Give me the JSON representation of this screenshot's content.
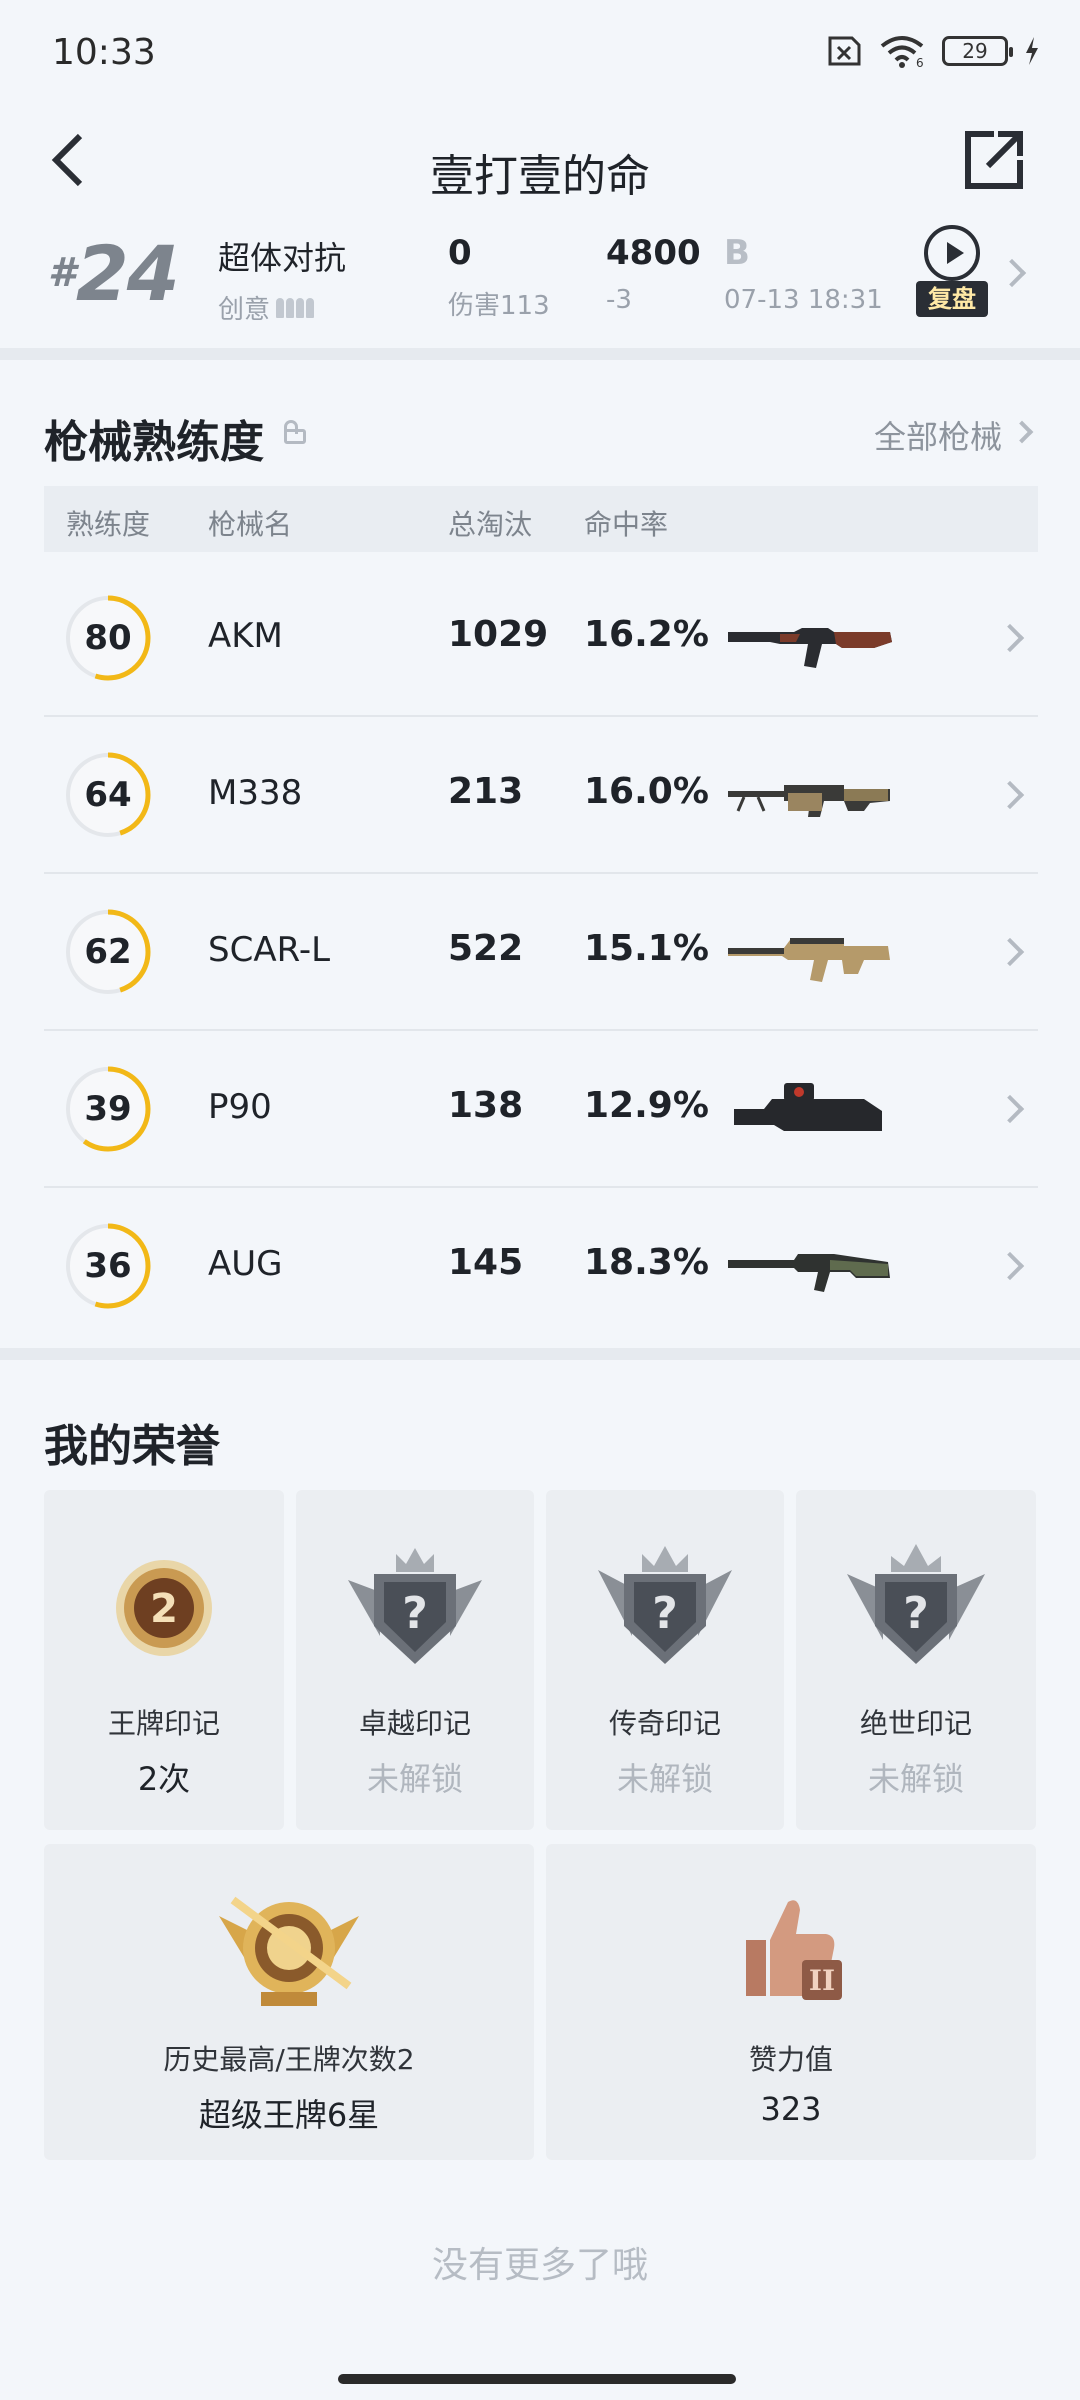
{
  "status": {
    "time": "10:33",
    "battery": "29",
    "wifi_level": "6"
  },
  "header": {
    "title": "壹打壹的命"
  },
  "match": {
    "rank_prefix": "#",
    "rank": "24",
    "mode": "超体对抗",
    "mode_sub": "创意",
    "damage_value": "0",
    "damage_label": "伤害113",
    "score": "4800",
    "score_change": "-3",
    "grade": "B",
    "time": "07-13 18:31",
    "replay_label": "复盘"
  },
  "weapons": {
    "title": "枪械熟练度",
    "all_label": "全部枪械",
    "columns": [
      "熟练度",
      "枪械名",
      "总淘汰",
      "命中率"
    ],
    "rows": [
      {
        "level": "80",
        "name": "AKM",
        "kills": "1029",
        "rate": "16.2%",
        "progress": 0.55
      },
      {
        "level": "64",
        "name": "M338",
        "kills": "213",
        "rate": "16.0%",
        "progress": 0.45
      },
      {
        "level": "62",
        "name": "SCAR-L",
        "kills": "522",
        "rate": "15.1%",
        "progress": 0.45
      },
      {
        "level": "39",
        "name": "P90",
        "kills": "138",
        "rate": "12.9%",
        "progress": 0.6
      },
      {
        "level": "36",
        "name": "AUG",
        "kills": "145",
        "rate": "18.3%",
        "progress": 0.55
      }
    ]
  },
  "honors": {
    "title": "我的荣誉",
    "cards": [
      {
        "label": "王牌印记",
        "value": "2次",
        "badge_num": "2"
      },
      {
        "label": "卓越印记",
        "value": "未解锁"
      },
      {
        "label": "传奇印记",
        "value": "未解锁"
      },
      {
        "label": "绝世印记",
        "value": "未解锁"
      }
    ],
    "wide_cards": [
      {
        "label": "历史最高/王牌次数2",
        "value": "超级王牌6星"
      },
      {
        "label": "赞力值",
        "value": "323"
      }
    ]
  },
  "footer": {
    "no_more": "没有更多了哦"
  },
  "colors": {
    "ring": "#f2b817",
    "ring_track": "#e4e7eb",
    "background": "#f3f6fa"
  },
  "icons": {
    "back": "chevron-left-icon",
    "share": "share-external-icon",
    "replay": "play-circle-icon",
    "lock": "lock-icon"
  }
}
